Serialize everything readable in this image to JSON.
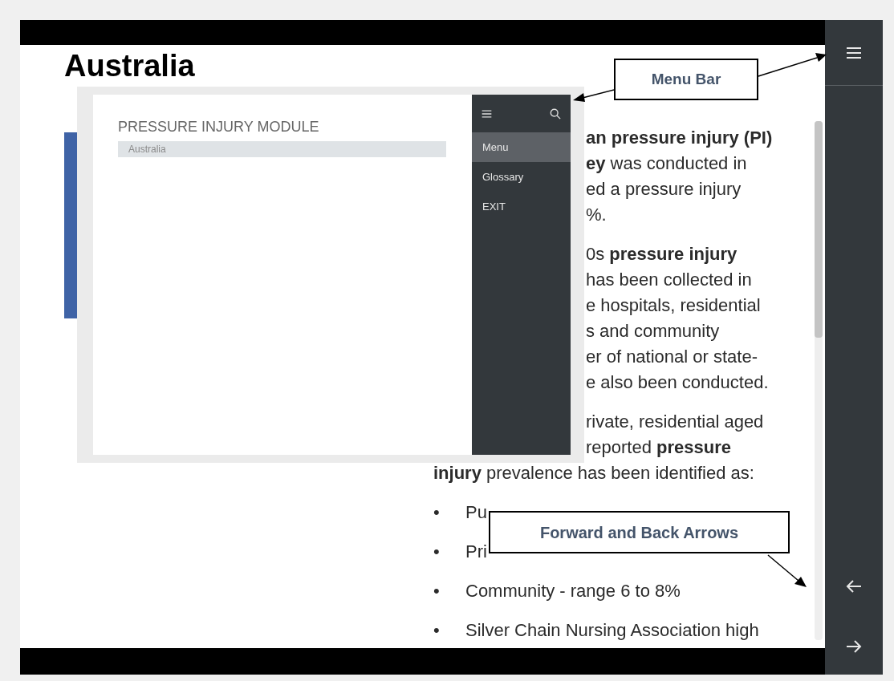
{
  "slide": {
    "title": "Australia",
    "paragraphs": [
      {
        "lines": [
          {
            "kind": "clipped",
            "text": "**an pressure injury (PI)**"
          },
          {
            "kind": "clipped",
            "text": "**ey** was conducted in"
          },
          {
            "kind": "clipped",
            "text": "ed a pressure injury"
          },
          {
            "kind": "clipped",
            "text": "%."
          }
        ]
      },
      {
        "lines": [
          {
            "kind": "clipped",
            "text": "0s **pressure injury**"
          },
          {
            "kind": "clipped",
            "text": "has been collected in"
          },
          {
            "kind": "clipped",
            "text": "e hospitals, residential"
          },
          {
            "kind": "clipped",
            "text": "s and community"
          },
          {
            "kind": "clipped",
            "text": "er of national or state-"
          },
          {
            "kind": "clipped",
            "text": "e also been conducted."
          }
        ]
      },
      {
        "lines": [
          {
            "kind": "clipped",
            "text": "rivate, residential aged"
          },
          {
            "kind": "clipped",
            "text": "reported **pressure**"
          },
          {
            "kind": "full",
            "text": "**injury** prevalence has been identified as:"
          }
        ]
      }
    ],
    "bullets": [
      {
        "marker": "•",
        "text": "Pu"
      },
      {
        "marker": "•",
        "text": "Pri"
      },
      {
        "marker": "•",
        "text": "Community - range 6 to 8%"
      },
      {
        "marker": "•",
        "text": "Silver Chain Nursing Association high"
      }
    ]
  },
  "inset": {
    "title": "PRESSURE INJURY MODULE",
    "breadcrumb": "Australia",
    "menu": [
      {
        "label": "Menu",
        "selected": true
      },
      {
        "label": "Glossary",
        "selected": false
      },
      {
        "label": "EXIT",
        "selected": false
      }
    ]
  },
  "callouts": [
    {
      "label": "Menu Bar"
    },
    {
      "label": "Forward and Back Arrows"
    }
  ]
}
